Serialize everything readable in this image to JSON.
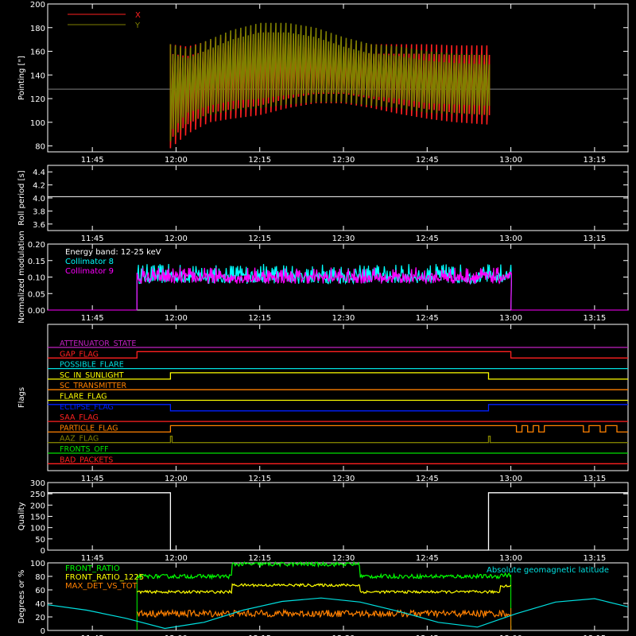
{
  "time_ticks": [
    "11:45",
    "12:00",
    "12:15",
    "12:30",
    "12:45",
    "13:00",
    "13:15"
  ],
  "chart_data": [
    {
      "type": "line",
      "ylabel": "Pointing [\"]",
      "ylim": [
        75,
        200
      ],
      "yticks": [
        80,
        100,
        120,
        140,
        160,
        180,
        200
      ],
      "xlim": [
        "11:37",
        "13:21"
      ],
      "reference_line": 128,
      "series": [
        {
          "name": "X",
          "color": "#ff2020",
          "x": [
            "11:59",
            "12:02",
            "12:06",
            "12:10",
            "12:15",
            "12:20",
            "12:25",
            "12:30",
            "12:35",
            "12:40",
            "12:45",
            "12:50",
            "12:56"
          ],
          "upper": [
            166,
            164,
            169,
            174,
            178,
            174,
            170,
            167,
            166,
            166,
            166,
            165,
            165
          ],
          "lower": [
            78,
            90,
            100,
            103,
            106,
            112,
            116,
            116,
            112,
            107,
            103,
            100,
            98
          ]
        },
        {
          "name": "Y",
          "color": "#808000",
          "x": [
            "11:59",
            "12:02",
            "12:06",
            "12:10",
            "12:15",
            "12:20",
            "12:25",
            "12:30",
            "12:35",
            "12:40",
            "12:45",
            "12:50",
            "12:56"
          ],
          "upper": [
            166,
            162,
            170,
            178,
            184,
            184,
            180,
            172,
            166,
            164,
            160,
            158,
            157
          ],
          "lower": [
            84,
            100,
            106,
            110,
            112,
            115,
            117,
            117,
            114,
            112,
            108,
            107,
            106
          ]
        }
      ]
    },
    {
      "type": "line",
      "ylabel": "Roll period [s]",
      "ylim": [
        3.5,
        4.5
      ],
      "yticks": [
        3.6,
        3.8,
        4.0,
        4.2,
        4.4
      ],
      "series": [
        {
          "name": "",
          "color": "#ffffff",
          "x": [
            "11:37",
            "13:21"
          ],
          "values": [
            4.02,
            4.02
          ]
        }
      ]
    },
    {
      "type": "line",
      "ylabel": "Normalized modulation",
      "ylim": [
        0,
        0.2
      ],
      "yticks": [
        0.0,
        0.05,
        0.1,
        0.15,
        0.2
      ],
      "start": "11:53",
      "end": "13:00",
      "legend": [
        "Energy band: 12-25 keV",
        "Collimator 8",
        "Collimator 9"
      ],
      "series": [
        {
          "name": "Collimator 8",
          "color": "#00ffff",
          "mean": 0.1,
          "min": 0.08,
          "max": 0.14
        },
        {
          "name": "Collimator 9",
          "color": "#ff00ff",
          "mean": 0.1,
          "min": 0.08,
          "max": 0.13
        }
      ]
    },
    {
      "type": "flags",
      "ylabel": "Flags",
      "flags": [
        {
          "name": "ATTENUATOR_STATE",
          "color": "#c020c0",
          "steps": []
        },
        {
          "name": "GAP_FLAG",
          "color": "#ff2020",
          "steps": [
            [
              "11:53",
              1
            ],
            [
              "13:00",
              0
            ]
          ]
        },
        {
          "name": "POSSIBLE_FLARE",
          "color": "#00e0e0",
          "steps": []
        },
        {
          "name": "SC_IN_SUNLIGHT",
          "color": "#ffff00",
          "steps": [
            [
              "11:59",
              1
            ],
            [
              "12:56",
              0
            ]
          ]
        },
        {
          "name": "SC_TRANSMITTER",
          "color": "#ff8000",
          "steps": []
        },
        {
          "name": "FLARE_FLAG",
          "color": "#ffff00",
          "steps": []
        },
        {
          "name": "ECLIPSE_FLAG",
          "color": "#0020ff",
          "steps": [
            [
              "11:59",
              0
            ],
            [
              "12:56",
              1
            ]
          ],
          "initial": 1
        },
        {
          "name": "SAA_FLAG",
          "color": "#ff2020",
          "steps": []
        },
        {
          "name": "PARTICLE_FLAG",
          "color": "#ff8000",
          "steps": [
            [
              "11:59",
              1
            ],
            [
              "13:01",
              0
            ],
            [
              "13:02",
              1
            ],
            [
              "13:03",
              0
            ],
            [
              "13:04",
              1
            ],
            [
              "13:05",
              0
            ],
            [
              "13:06",
              1
            ],
            [
              "13:13",
              0
            ],
            [
              "13:14",
              1
            ],
            [
              "13:16",
              0
            ],
            [
              "13:17",
              1
            ],
            [
              "13:19",
              0
            ]
          ]
        },
        {
          "name": "AAZ_FLAG",
          "color": "#808000",
          "steps": [
            [
              "11:59",
              1
            ],
            [
              "11:59.3",
              0
            ],
            [
              "12:56",
              1
            ],
            [
              "12:56.3",
              0
            ]
          ]
        },
        {
          "name": "FRONTS_OFF",
          "color": "#00e000",
          "steps": []
        },
        {
          "name": "BAD_PACKETS",
          "color": "#ff2020",
          "steps": []
        }
      ]
    },
    {
      "type": "line",
      "ylabel": "Quality",
      "ylim": [
        0,
        300
      ],
      "yticks": [
        0,
        50,
        100,
        150,
        200,
        250,
        300
      ],
      "series": [
        {
          "name": "",
          "color": "#ffffff",
          "x": [
            "11:37",
            "11:59",
            "11:59",
            "12:56",
            "12:56",
            "13:21"
          ],
          "values": [
            255,
            255,
            0,
            0,
            255,
            255
          ]
        }
      ]
    },
    {
      "type": "line",
      "ylabel": "Degrees or %",
      "ylim": [
        0,
        100
      ],
      "yticks": [
        0,
        20,
        40,
        60,
        80,
        100
      ],
      "series": [
        {
          "name": "FRONT_RATIO",
          "color": "#00ff00",
          "x": [
            "11:53",
            "12:10",
            "12:10",
            "12:33",
            "12:33",
            "12:58",
            "12:58",
            "13:00"
          ],
          "values": [
            80,
            80,
            98,
            98,
            80,
            80,
            82,
            82
          ],
          "noise": 3
        },
        {
          "name": "FRONT_RATIO_1225",
          "color": "#ffff00",
          "x": [
            "11:53",
            "12:10",
            "12:10",
            "12:33",
            "12:33",
            "12:58",
            "12:58",
            "13:00"
          ],
          "values": [
            57,
            57,
            67,
            67,
            57,
            57,
            66,
            66
          ],
          "noise": 2
        },
        {
          "name": "MAX_DET_VS_TOT",
          "color": "#ff8000",
          "x": [
            "11:53",
            "13:00"
          ],
          "values": [
            25,
            25
          ],
          "noise": 5
        },
        {
          "name": "Absolute geomagnetic latitude",
          "color": "#00e0e0",
          "x": [
            "11:37",
            "11:44",
            "11:51",
            "11:58",
            "12:05",
            "12:12",
            "12:19",
            "12:26",
            "12:33",
            "12:40",
            "12:47",
            "12:54",
            "13:01",
            "13:08",
            "13:15",
            "13:21"
          ],
          "values": [
            38,
            30,
            18,
            3,
            12,
            30,
            43,
            48,
            42,
            28,
            12,
            5,
            25,
            42,
            47,
            35
          ]
        }
      ]
    }
  ]
}
